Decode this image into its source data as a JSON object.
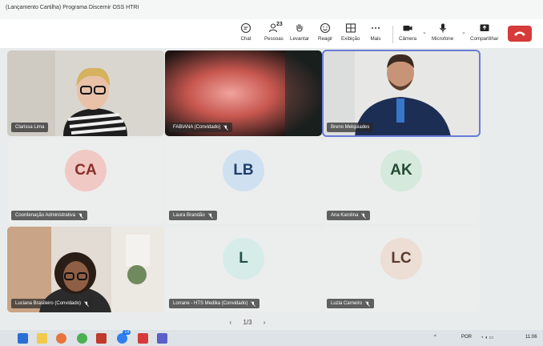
{
  "window": {
    "title": "(Lançamento Cartilha) Programa Discernir OSS HTRI"
  },
  "toolbar": {
    "chat": "Chat",
    "people": "Pessoas",
    "people_count": "23",
    "raise": "Levantar",
    "react": "Reagir",
    "view": "Exibição",
    "more": "Mais",
    "camera": "Câmera",
    "mic": "Microfone",
    "share": "Compartilhar"
  },
  "participants": [
    {
      "name": "Clarissa Lima",
      "type": "video",
      "muted": false
    },
    {
      "name": "FABIANA (Convidado)",
      "type": "video",
      "muted": true
    },
    {
      "name": "Breno Melquiades",
      "type": "video",
      "muted": false,
      "selected": true
    },
    {
      "name": "Coordenação Administrativa",
      "type": "avatar",
      "initials": "CA",
      "avatar_bg": "#f1c9c4",
      "avatar_fg": "#8a2f2a",
      "muted": true
    },
    {
      "name": "Laura Brandão",
      "type": "avatar",
      "initials": "LB",
      "avatar_bg": "#cfe0f1",
      "avatar_fg": "#1f3f6a",
      "muted": true
    },
    {
      "name": "Ana Karolina",
      "type": "avatar",
      "initials": "AK",
      "avatar_bg": "#d5e9dc",
      "avatar_fg": "#254a33",
      "muted": true
    },
    {
      "name": "Luciana Brasileiro (Convidado)",
      "type": "video",
      "muted": true
    },
    {
      "name": "Lorrane - HTS Medika (Convidado)",
      "type": "avatar",
      "initials": "L",
      "avatar_bg": "#d5ece9",
      "avatar_fg": "#23504a",
      "muted": true
    },
    {
      "name": "Luzia Carneiro",
      "type": "avatar",
      "initials": "LC",
      "avatar_bg": "#ecddd5",
      "avatar_fg": "#5a3a2a",
      "muted": true
    }
  ],
  "pagination": {
    "prev": "‹",
    "current": "1/3",
    "next": "›"
  },
  "taskbar": {
    "lang": "POR",
    "time": "11:06",
    "notif_badge": "14"
  }
}
